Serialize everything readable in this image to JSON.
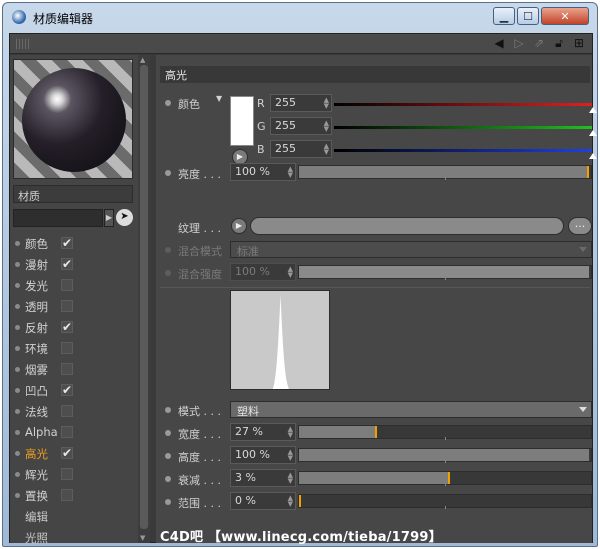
{
  "window": {
    "title": "材质编辑器"
  },
  "material": {
    "name": "材质"
  },
  "channels": [
    {
      "label": "颜色",
      "checked": true,
      "active": false
    },
    {
      "label": "漫射",
      "checked": true,
      "active": false
    },
    {
      "label": "发光",
      "checked": false,
      "active": false
    },
    {
      "label": "透明",
      "checked": false,
      "active": false
    },
    {
      "label": "反射",
      "checked": true,
      "active": false
    },
    {
      "label": "环境",
      "checked": false,
      "active": false
    },
    {
      "label": "烟雾",
      "checked": false,
      "active": false
    },
    {
      "label": "凹凸",
      "checked": true,
      "active": false
    },
    {
      "label": "法线",
      "checked": false,
      "active": false
    },
    {
      "label": "Alpha",
      "checked": false,
      "active": false
    },
    {
      "label": "高光",
      "checked": true,
      "active": true
    },
    {
      "label": "辉光",
      "checked": false,
      "active": false
    },
    {
      "label": "置换",
      "checked": false,
      "active": false
    }
  ],
  "extra_items": [
    "编辑",
    "光照"
  ],
  "panel": {
    "title": "高光",
    "color": {
      "label": "颜色",
      "r_label": "R",
      "r": "255",
      "g_label": "G",
      "g": "255",
      "b_label": "B",
      "b": "255",
      "swatch_color": "#ffffff"
    },
    "brightness": {
      "label": "亮度 . . .",
      "value": "100 %",
      "fraction": 1.0
    },
    "texture": {
      "label": "纹理 . . .",
      "dots": "..."
    },
    "blend_mode": {
      "label": "混合模式",
      "value": "标准"
    },
    "blend_strength": {
      "label": "混合强度",
      "value": "100 %",
      "fraction": 1.0
    },
    "mode": {
      "label": "模式 . . .",
      "value": "塑料"
    },
    "width": {
      "label": "宽度 . . .",
      "value": "27 %",
      "fraction": 0.27
    },
    "height": {
      "label": "高度 . . .",
      "value": "100 %",
      "fraction": 1.0
    },
    "falloff": {
      "label": "衰减 . . .",
      "value": "3 %",
      "fraction": 0.52
    },
    "inner_width": {
      "label": "范围 . . .",
      "value": "0 %",
      "fraction": 0.0
    }
  },
  "watermark": "C4D吧 【www.linecg.com/tieba/1799】",
  "colors": {
    "accent": "#f0a020",
    "red": "#e02020",
    "green": "#20c020",
    "blue": "#2040e0"
  }
}
